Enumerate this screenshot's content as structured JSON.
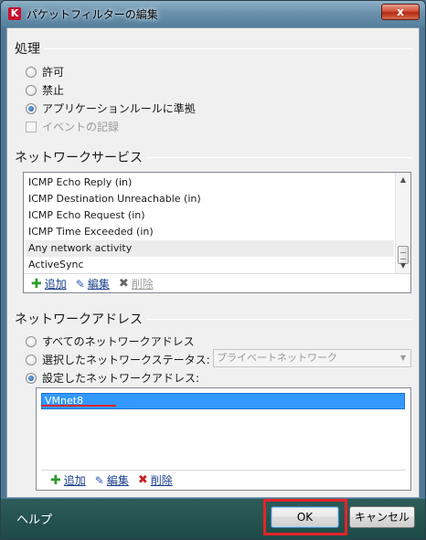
{
  "window": {
    "title": "パケットフィルターの編集",
    "close_glyph": "x"
  },
  "action": {
    "heading": "処理",
    "options": [
      {
        "label": "許可",
        "checked": false
      },
      {
        "label": "禁止",
        "checked": false
      },
      {
        "label": "アプリケーションルールに準拠",
        "checked": true
      }
    ],
    "log_checkbox": {
      "label": "イベントの記録",
      "checked": false,
      "disabled": true
    }
  },
  "network_services": {
    "heading": "ネットワークサービス",
    "items": [
      "ICMP Echo Reply (in)",
      "ICMP Destination Unreachable (in)",
      "ICMP Echo Request (in)",
      "ICMP Time Exceeded (in)",
      "Any network activity",
      "ActiveSync"
    ],
    "highlighted_index": 4,
    "toolbar": {
      "add": "追加",
      "edit": "編集",
      "delete": "削除"
    }
  },
  "network_address": {
    "heading": "ネットワークアドレス",
    "options": [
      {
        "label": "すべてのネットワークアドレス",
        "checked": false
      },
      {
        "label": "選択したネットワークステータス:",
        "checked": false
      },
      {
        "label": "設定したネットワークアドレス:",
        "checked": true
      }
    ],
    "status_select_value": "プライベートネットワーク",
    "addresses": [
      "VMnet8"
    ],
    "toolbar": {
      "add": "追加",
      "edit": "編集",
      "delete": "削除"
    }
  },
  "footer": {
    "help": "ヘルプ",
    "ok": "OK",
    "cancel": "キャンセル"
  },
  "colors": {
    "footer_bg": "#1d4a47",
    "selection": "#3399ff",
    "highlight_box": "#e2242b"
  }
}
